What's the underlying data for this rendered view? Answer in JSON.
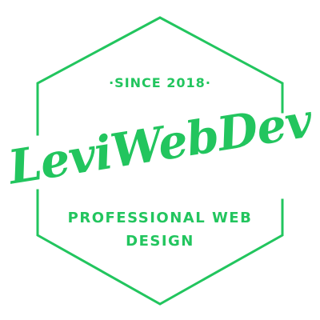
{
  "logo": {
    "since_text": "·SINCE 2018·",
    "brand_name": "LeviWebDev",
    "tagline_line1": "PROFESSIONAL WEB",
    "tagline_line2": "DESIGN"
  },
  "colors": {
    "brand_green": "#22c55e",
    "background": "#ffffff"
  }
}
